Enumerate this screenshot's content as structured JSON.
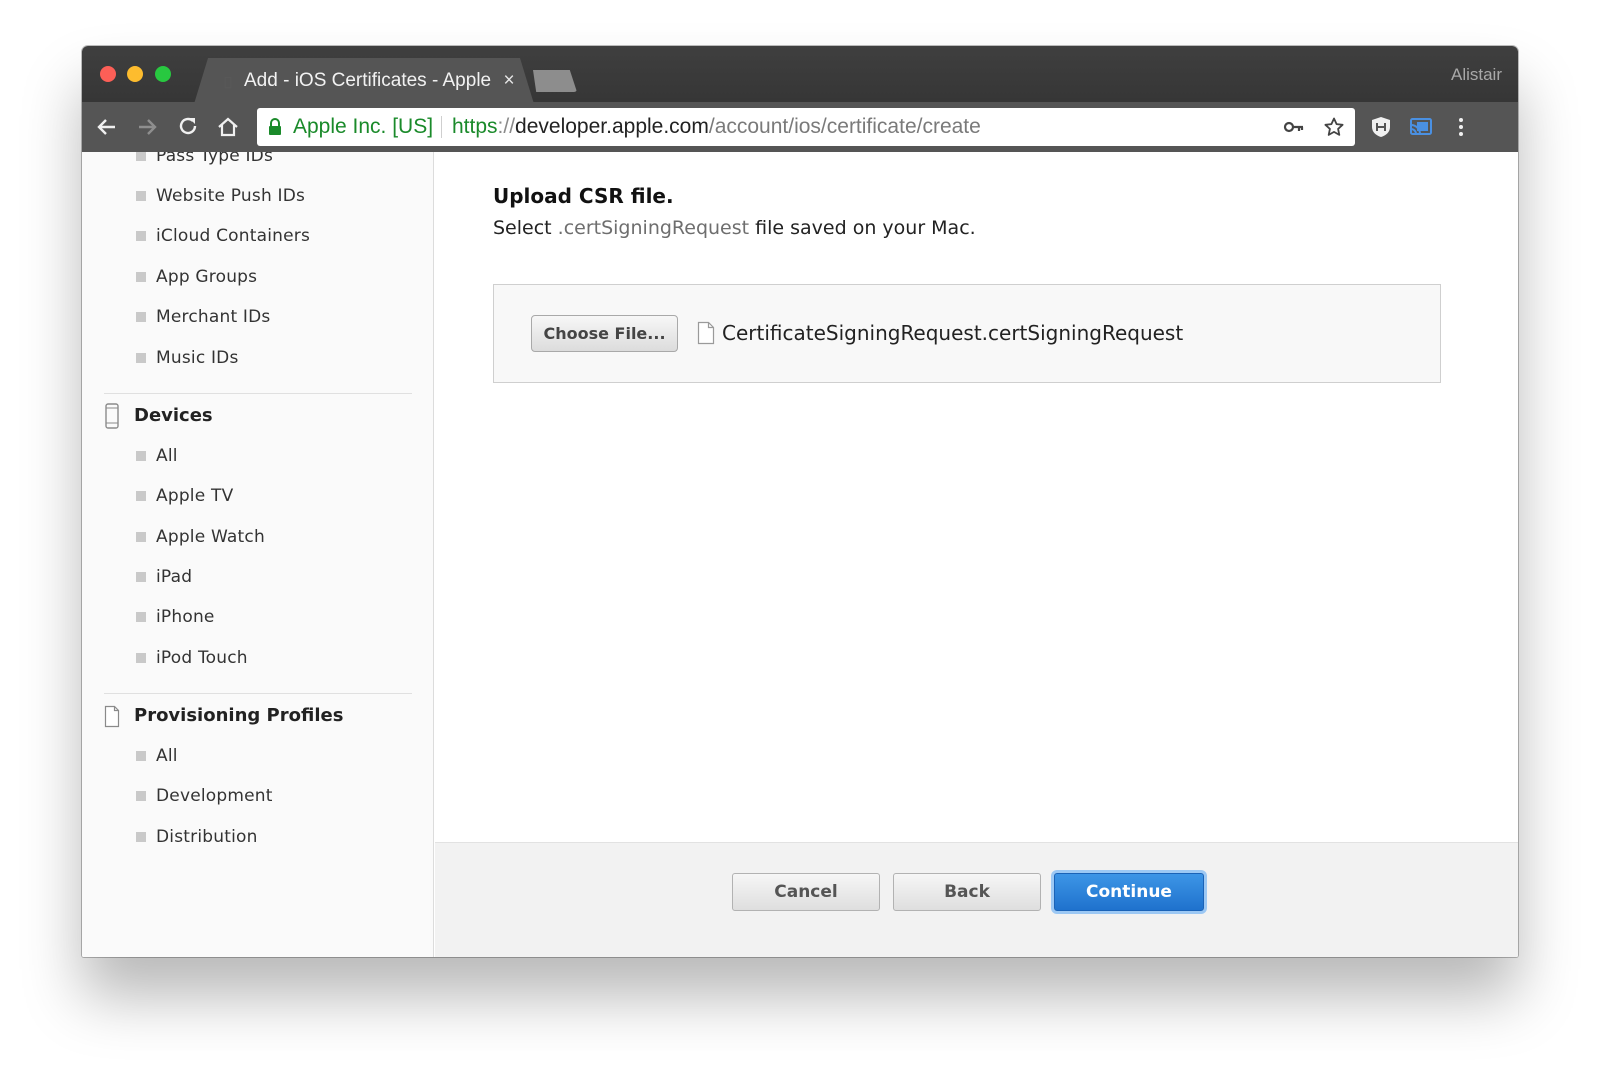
{
  "browser": {
    "tab_title": "Add - iOS Certificates - Apple",
    "tab_close": "×",
    "user_name": "Alistair",
    "ev_label": "Apple Inc. [US]",
    "url": {
      "scheme": "https",
      "separator": "://",
      "host": "developer.apple.com",
      "path": "/account/ios/certificate/create"
    },
    "icons": [
      "back-icon",
      "forward-icon",
      "reload-icon",
      "home-icon",
      "lock-icon",
      "key-icon",
      "star-icon",
      "shield-extension-icon",
      "cast-icon",
      "menu-icon"
    ]
  },
  "sidebar": {
    "top_items": [
      {
        "label": "Pass Type IDs"
      },
      {
        "label": "Website Push IDs"
      },
      {
        "label": "iCloud Containers"
      },
      {
        "label": "App Groups"
      },
      {
        "label": "Merchant IDs"
      },
      {
        "label": "Music IDs"
      }
    ],
    "devices": {
      "title": "Devices",
      "items": [
        {
          "label": "All"
        },
        {
          "label": "Apple TV"
        },
        {
          "label": "Apple Watch"
        },
        {
          "label": "iPad"
        },
        {
          "label": "iPhone"
        },
        {
          "label": "iPod Touch"
        }
      ]
    },
    "profiles": {
      "title": "Provisioning Profiles",
      "items": [
        {
          "label": "All"
        },
        {
          "label": "Development"
        },
        {
          "label": "Distribution"
        }
      ]
    }
  },
  "main": {
    "title": "Upload CSR file.",
    "subtitle_pre": "Select ",
    "subtitle_ext": ".certSigningRequest",
    "subtitle_post": " file saved on your Mac.",
    "choose_file_label": "Choose File...",
    "file_name": "CertificateSigningRequest.certSigningRequest"
  },
  "footer": {
    "cancel_label": "Cancel",
    "back_label": "Back",
    "continue_label": "Continue"
  },
  "colors": {
    "ev_green": "#1a8a2a",
    "continue_blue": "#2a7fd8",
    "chrome_dark": "#555555"
  }
}
